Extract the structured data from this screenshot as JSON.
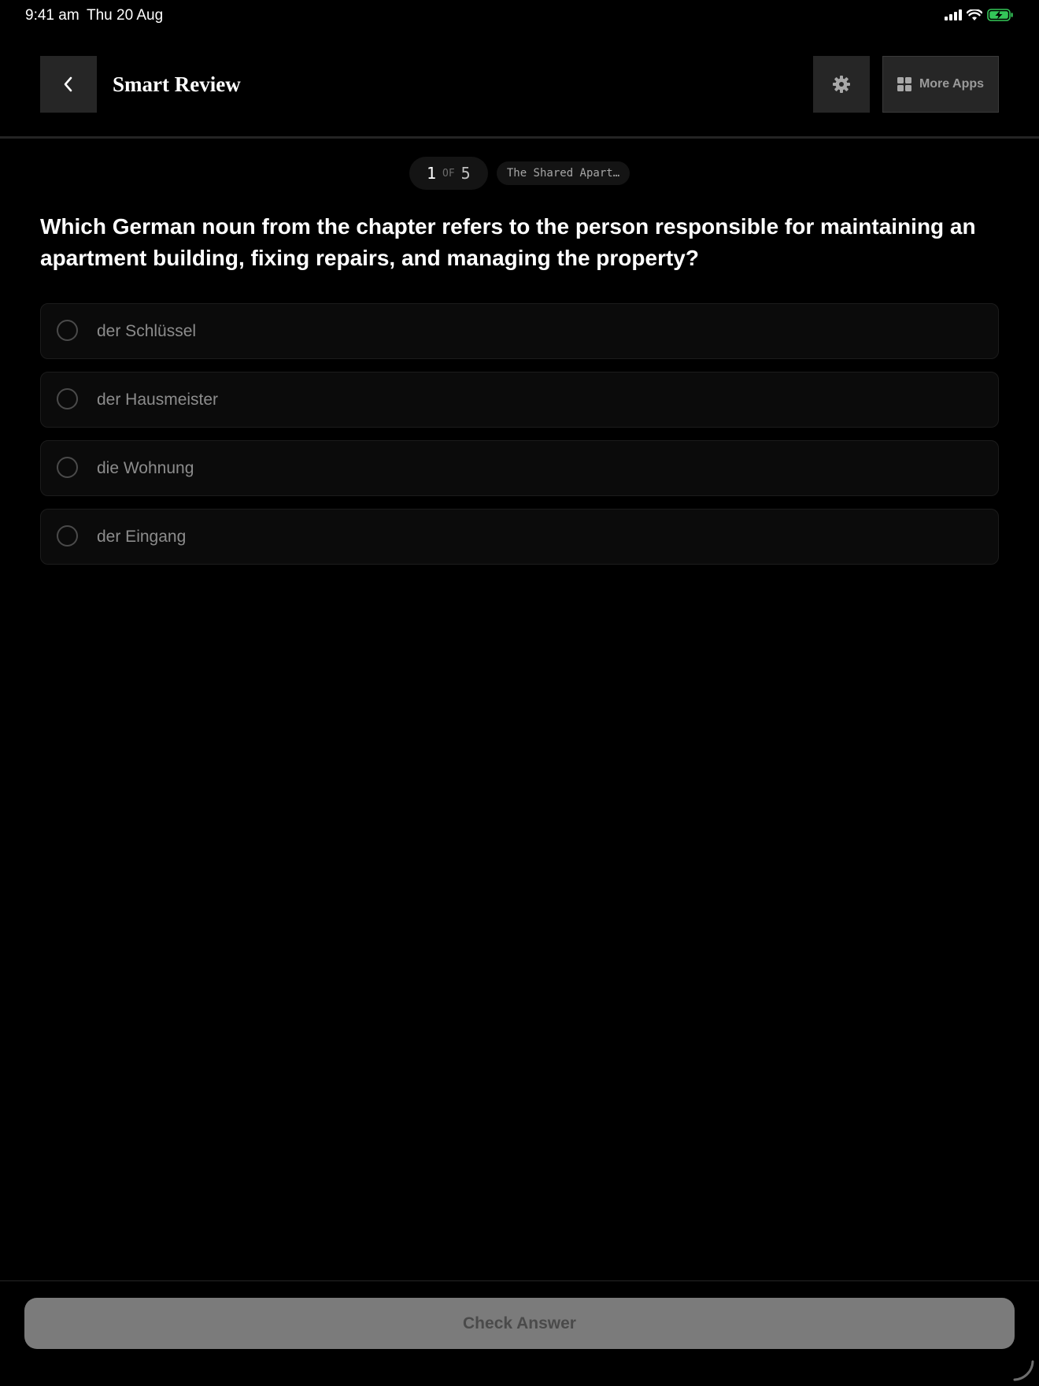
{
  "status_bar": {
    "time": "9:41 am",
    "date": "Thu 20 Aug",
    "battery_color": "#34c759"
  },
  "header": {
    "title": "Smart Review",
    "back_icon": "chevron-left-icon",
    "settings_icon": "gear-icon",
    "more_apps_icon": "grid-icon",
    "more_apps_label": "More Apps"
  },
  "progress": {
    "current": "1",
    "of_label": "OF",
    "total": "5",
    "chapter": "The Shared Apart…"
  },
  "question": {
    "text": "Which German noun from the chapter refers to the person responsible for maintaining an apartment building, fixing repairs, and managing the property?"
  },
  "options": [
    {
      "label": "der Schlüssel",
      "selected": false
    },
    {
      "label": "der Hausmeister",
      "selected": false
    },
    {
      "label": "die Wohnung",
      "selected": false
    },
    {
      "label": "der Eingang",
      "selected": false
    }
  ],
  "footer": {
    "check_answer_label": "Check Answer"
  }
}
